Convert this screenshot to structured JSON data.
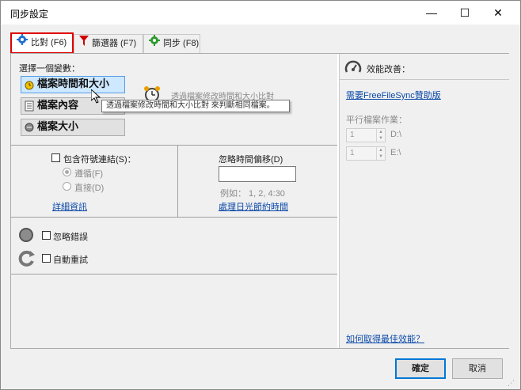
{
  "window": {
    "title": "同步設定",
    "controls": {
      "minimize": "—",
      "maximize": "☐",
      "close": "✕"
    }
  },
  "tabs": [
    {
      "label": "比對 (F6)",
      "icon": "gear-icon",
      "active": true
    },
    {
      "label": "篩選器 (F7)",
      "icon": "filter-icon",
      "active": false
    },
    {
      "label": "同步 (F8)",
      "icon": "sync-gear-icon",
      "active": false
    }
  ],
  "compare": {
    "variant_prompt": "選擇一個變數：",
    "variants": [
      {
        "label": "檔案時間和大小",
        "icon": "clock-icon",
        "selected": true
      },
      {
        "label": "檔案內容",
        "icon": "file-content-icon",
        "selected": false
      },
      {
        "label": "檔案大小",
        "icon": "size-icon",
        "selected": false
      }
    ],
    "description": "透過檔案修改時間和大小比對",
    "tooltip": "透過檔案修改時間和大小比對 來判斷相同檔案。",
    "symlinks": {
      "label": "包含符號連結(S)：",
      "options": [
        "遵循(F)",
        "直接(D)"
      ],
      "details_link": "詳細資訊"
    },
    "time_shift": {
      "label": "忽略時間偏移(D)",
      "value": "",
      "example": "例如： 1, 2, 4:30",
      "dst_link": "處理日光節約時間"
    },
    "ignore_errors": "忽略錯誤",
    "auto_retry": "自動重試"
  },
  "performance": {
    "title": "效能改善：",
    "donation_link": "需要FreeFileSync贊助版",
    "parallel_label": "平行檔案作業：",
    "rows": [
      {
        "value": "1",
        "path": "D:\\"
      },
      {
        "value": "1",
        "path": "E:\\"
      }
    ],
    "best_link": "如何取得最佳效能？"
  },
  "buttons": {
    "ok": "確定",
    "cancel": "取消"
  },
  "colors": {
    "accent": "#0078d7",
    "tab_highlight": "#e00000",
    "link": "#0a48a8"
  }
}
